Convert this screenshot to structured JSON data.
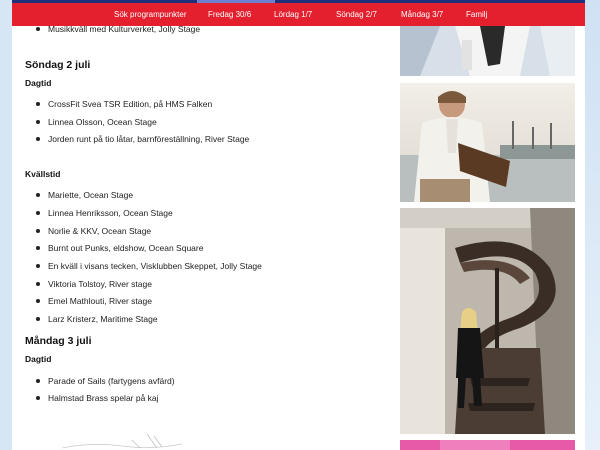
{
  "nav": {
    "items": [
      {
        "label": "Sök programpunkter"
      },
      {
        "label": "Fredag 30/6"
      },
      {
        "label": "Lördag 1/7"
      },
      {
        "label": "Söndag 2/7"
      },
      {
        "label": "Måndag 3/7"
      },
      {
        "label": "Familj"
      }
    ],
    "bar_color": "#e4202e"
  },
  "schedule": {
    "top_partial_item": "Musikkväll med Kulturverket, Jolly Stage",
    "days": [
      {
        "heading": "Söndag 2 juli",
        "sections": [
          {
            "label": "Dagtid",
            "items": [
              "CrossFit Svea TSR Edition, på HMS Falken",
              "Linnea Olsson, Ocean Stage",
              "Jorden runt på tio låtar, barnföreställning, River Stage"
            ]
          },
          {
            "label": "Kvällstid",
            "items": [
              "Mariette, Ocean Stage",
              "Linnea Henriksson, Ocean Stage",
              "Norlie & KKV, Ocean Stage",
              "Burnt out Punks, eldshow, Ocean Square",
              "En kväll i visans tecken, Visklubben Skeppet, Jolly Stage",
              "Viktoria Tolstoy, River stage",
              "Emel Mathlouti, River stage",
              "Larz Kristerz, Maritime Stage"
            ]
          }
        ]
      },
      {
        "heading": "Måndag 3 juli",
        "sections": [
          {
            "label": "Dagtid",
            "items": [
              "Parade of Sails (fartygens avfärd)",
              "Halmstad Brass spelar på kaj"
            ]
          }
        ]
      }
    ]
  }
}
